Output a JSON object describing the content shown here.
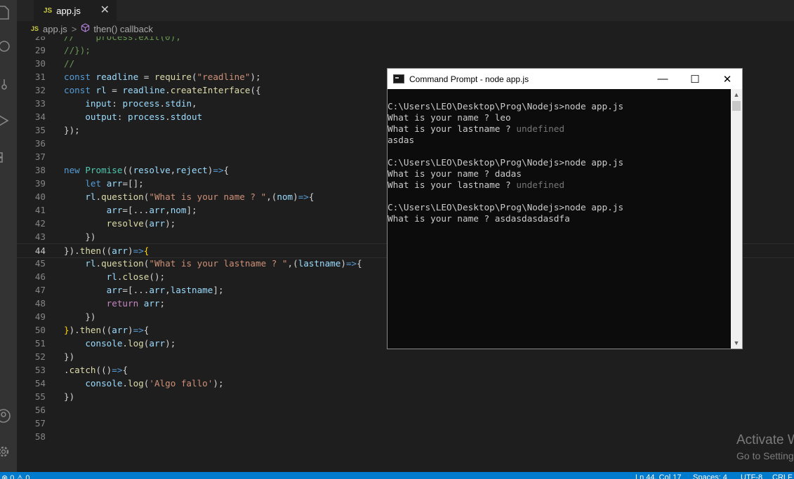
{
  "tab": {
    "badge": "JS",
    "name": "app.js",
    "close": "✕"
  },
  "breadcrumb": {
    "badge": "JS",
    "file": "app.js",
    "separator": ">",
    "symbol": "then() callback"
  },
  "editor": {
    "first_line_number": 28,
    "current_line": 44,
    "lines": [
      {
        "n": "28",
        "t": [
          [
            "com",
            "//    process.exit(0);"
          ]
        ]
      },
      {
        "n": "29",
        "t": [
          [
            "com",
            "//});"
          ]
        ]
      },
      {
        "n": "30",
        "t": [
          [
            "com",
            "//"
          ]
        ]
      },
      {
        "n": "31",
        "t": [
          [
            "kw",
            "const "
          ],
          [
            "var",
            "readline"
          ],
          [
            "pu",
            " = "
          ],
          [
            "fn",
            "require"
          ],
          [
            "pu",
            "("
          ],
          [
            "str",
            "\"readline\""
          ],
          [
            "pu",
            ");"
          ]
        ]
      },
      {
        "n": "32",
        "t": [
          [
            "kw",
            "const "
          ],
          [
            "var",
            "rl"
          ],
          [
            "pu",
            " = "
          ],
          [
            "var",
            "readline"
          ],
          [
            "pu",
            "."
          ],
          [
            "fn",
            "createInterface"
          ],
          [
            "pu",
            "({"
          ]
        ]
      },
      {
        "n": "33",
        "t": [
          [
            "pu",
            "    "
          ],
          [
            "var",
            "input"
          ],
          [
            "pu",
            ": "
          ],
          [
            "var",
            "process"
          ],
          [
            "pu",
            "."
          ],
          [
            "var",
            "stdin"
          ],
          [
            "pu",
            ","
          ]
        ]
      },
      {
        "n": "34",
        "t": [
          [
            "pu",
            "    "
          ],
          [
            "var",
            "output"
          ],
          [
            "pu",
            ": "
          ],
          [
            "var",
            "process"
          ],
          [
            "pu",
            "."
          ],
          [
            "var",
            "stdout"
          ]
        ]
      },
      {
        "n": "35",
        "t": [
          [
            "pu",
            "});"
          ]
        ]
      },
      {
        "n": "36",
        "t": []
      },
      {
        "n": "37",
        "t": []
      },
      {
        "n": "38",
        "t": [
          [
            "kw",
            "new "
          ],
          [
            "ty",
            "Promise"
          ],
          [
            "pu",
            "(("
          ],
          [
            "var",
            "resolve"
          ],
          [
            "pu",
            ","
          ],
          [
            "var",
            "reject"
          ],
          [
            "pu",
            ")"
          ],
          [
            "kw",
            "=>"
          ],
          [
            "pu",
            "{"
          ]
        ]
      },
      {
        "n": "39",
        "t": [
          [
            "pu",
            "    "
          ],
          [
            "kw",
            "let "
          ],
          [
            "var",
            "arr"
          ],
          [
            "pu",
            "=[];"
          ]
        ]
      },
      {
        "n": "40",
        "t": [
          [
            "pu",
            "    "
          ],
          [
            "var",
            "rl"
          ],
          [
            "pu",
            "."
          ],
          [
            "fn",
            "question"
          ],
          [
            "pu",
            "("
          ],
          [
            "str",
            "\"What is your name ? \""
          ],
          [
            "pu",
            ",("
          ],
          [
            "var",
            "nom"
          ],
          [
            "pu",
            ")"
          ],
          [
            "kw",
            "=>"
          ],
          [
            "pu",
            "{"
          ]
        ]
      },
      {
        "n": "41",
        "t": [
          [
            "pu",
            "        "
          ],
          [
            "var",
            "arr"
          ],
          [
            "pu",
            "=[..."
          ],
          [
            "var",
            "arr"
          ],
          [
            "pu",
            ","
          ],
          [
            "var",
            "nom"
          ],
          [
            "pu",
            "];"
          ]
        ]
      },
      {
        "n": "42",
        "t": [
          [
            "pu",
            "        "
          ],
          [
            "fn",
            "resolve"
          ],
          [
            "pu",
            "("
          ],
          [
            "var",
            "arr"
          ],
          [
            "pu",
            ");"
          ]
        ]
      },
      {
        "n": "43",
        "t": [
          [
            "pu",
            "    })"
          ]
        ]
      },
      {
        "n": "44",
        "t": [
          [
            "pu",
            "})."
          ],
          [
            "fn",
            "then"
          ],
          [
            "pu",
            "(("
          ],
          [
            "var",
            "arr"
          ],
          [
            "pu",
            ")"
          ],
          [
            "kw",
            "=>"
          ],
          [
            "br",
            "{"
          ]
        ]
      },
      {
        "n": "45",
        "t": [
          [
            "pu",
            "    "
          ],
          [
            "var",
            "rl"
          ],
          [
            "pu",
            "."
          ],
          [
            "fn",
            "question"
          ],
          [
            "pu",
            "("
          ],
          [
            "str",
            "\"What is your lastname ? \""
          ],
          [
            "pu",
            ",("
          ],
          [
            "var",
            "lastname"
          ],
          [
            "pu",
            ")"
          ],
          [
            "kw",
            "=>"
          ],
          [
            "pu",
            "{"
          ]
        ]
      },
      {
        "n": "46",
        "t": [
          [
            "pu",
            "        "
          ],
          [
            "var",
            "rl"
          ],
          [
            "pu",
            "."
          ],
          [
            "fn",
            "close"
          ],
          [
            "pu",
            "();"
          ]
        ]
      },
      {
        "n": "47",
        "t": [
          [
            "pu",
            "        "
          ],
          [
            "var",
            "arr"
          ],
          [
            "pu",
            "=[..."
          ],
          [
            "var",
            "arr"
          ],
          [
            "pu",
            ","
          ],
          [
            "var",
            "lastname"
          ],
          [
            "pu",
            "];"
          ]
        ]
      },
      {
        "n": "48",
        "t": [
          [
            "pu",
            "        "
          ],
          [
            "ctrl",
            "return "
          ],
          [
            "var",
            "arr"
          ],
          [
            "pu",
            ";"
          ]
        ]
      },
      {
        "n": "49",
        "t": [
          [
            "pu",
            "    })"
          ]
        ]
      },
      {
        "n": "50",
        "t": [
          [
            "br",
            "}"
          ],
          [
            "pu",
            ")."
          ],
          [
            "fn",
            "then"
          ],
          [
            "pu",
            "(("
          ],
          [
            "var",
            "arr"
          ],
          [
            "pu",
            ")"
          ],
          [
            "kw",
            "=>"
          ],
          [
            "pu",
            "{"
          ]
        ]
      },
      {
        "n": "51",
        "t": [
          [
            "pu",
            "    "
          ],
          [
            "var",
            "console"
          ],
          [
            "pu",
            "."
          ],
          [
            "fn",
            "log"
          ],
          [
            "pu",
            "("
          ],
          [
            "var",
            "arr"
          ],
          [
            "pu",
            ");"
          ]
        ]
      },
      {
        "n": "52",
        "t": [
          [
            "pu",
            "})"
          ]
        ]
      },
      {
        "n": "53",
        "t": [
          [
            "pu",
            "."
          ],
          [
            "fn",
            "catch"
          ],
          [
            "pu",
            "(()"
          ],
          [
            "kw",
            "=>"
          ],
          [
            "pu",
            "{"
          ]
        ]
      },
      {
        "n": "54",
        "t": [
          [
            "pu",
            "    "
          ],
          [
            "var",
            "console"
          ],
          [
            "pu",
            "."
          ],
          [
            "fn",
            "log"
          ],
          [
            "pu",
            "("
          ],
          [
            "str",
            "'Algo fallo'"
          ],
          [
            "pu",
            ");"
          ]
        ]
      },
      {
        "n": "55",
        "t": [
          [
            "pu",
            "})"
          ]
        ]
      },
      {
        "n": "56",
        "t": []
      },
      {
        "n": "57",
        "t": []
      },
      {
        "n": "58",
        "t": []
      }
    ]
  },
  "cmd_window": {
    "title": "Command Prompt - node  app.js",
    "minimize": "—",
    "maximize": "☐",
    "close": "✕",
    "scroll_up": "▲",
    "scroll_down": "▼",
    "output": [
      {
        "text": "C:\\Users\\LEO\\Desktop\\Prog\\Nodejs>node app.js",
        "dim": ""
      },
      {
        "text": "What is your name ? leo",
        "dim": ""
      },
      {
        "text": "What is your lastname ? ",
        "dim": "undefined"
      },
      {
        "text": "asdas",
        "dim": ""
      },
      {
        "text": "",
        "dim": ""
      },
      {
        "text": "C:\\Users\\LEO\\Desktop\\Prog\\Nodejs>node app.js",
        "dim": ""
      },
      {
        "text": "What is your name ? dadas",
        "dim": ""
      },
      {
        "text": "What is your lastname ? ",
        "dim": "undefined"
      },
      {
        "text": "",
        "dim": ""
      },
      {
        "text": "C:\\Users\\LEO\\Desktop\\Prog\\Nodejs>node app.js",
        "dim": ""
      },
      {
        "text": "What is your name ? asdasdasdasdfa",
        "dim": ""
      }
    ]
  },
  "watermark": {
    "line1": "Activate W",
    "line2": "Go to Setting"
  },
  "statusbar": {
    "problems": "⊗ 0 ⚠ 0",
    "position": "Ln 44, Col 17",
    "spaces": "Spaces: 4",
    "encoding": "UTF-8",
    "eol": "CRLF"
  },
  "activity_icons": [
    "explorer-icon",
    "search-icon",
    "source-control-icon",
    "run-debug-icon",
    "extensions-icon",
    "account-icon",
    "settings-gear-icon"
  ]
}
